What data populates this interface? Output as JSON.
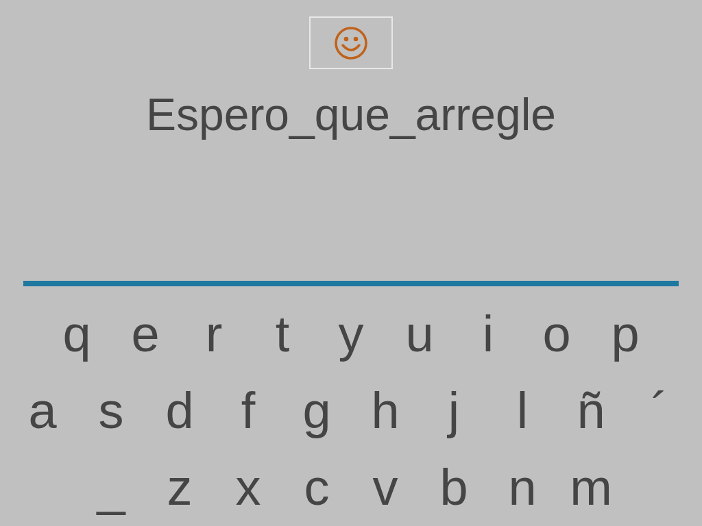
{
  "phrase": "Espero_que_arregle",
  "keyboard": [
    [
      "q",
      "e",
      "r",
      "t",
      "y",
      "u",
      "i",
      "o",
      "p"
    ],
    [
      "a",
      "s",
      "d",
      "f",
      "g",
      "h",
      "j",
      "l",
      "ñ",
      "´"
    ],
    [
      "_",
      "z",
      "x",
      "c",
      "v",
      "b",
      "n",
      "m"
    ]
  ]
}
